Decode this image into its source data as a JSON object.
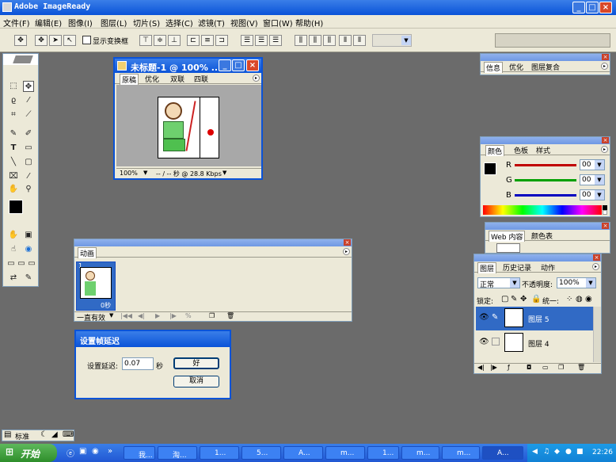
{
  "app": {
    "title": "Adobe ImageReady"
  },
  "window_buttons": {
    "minimize": "_",
    "maximize": "□",
    "close": "×"
  },
  "menu": {
    "items": [
      "文件(F)",
      "编辑(E)",
      "图像(I)",
      "图层(L)",
      "切片(S)",
      "选择(C)",
      "滤镜(T)",
      "视图(V)",
      "窗口(W)",
      "帮助(H)"
    ]
  },
  "options_bar": {
    "show_transform_label": "显示变换框"
  },
  "document": {
    "title": "未标题-1 @ 100% ...",
    "tabs": [
      "原稿",
      "优化",
      "双联",
      "四联"
    ],
    "zoom": "100%",
    "status": "-- / -- 秒 @ 28.8 Kbps"
  },
  "info_panel": {
    "tabs": [
      "信息",
      "优化",
      "图层复合"
    ]
  },
  "color_panel": {
    "tabs": [
      "颜色",
      "色板",
      "样式"
    ],
    "channels": [
      {
        "label": "R",
        "value": "00",
        "color": "#c00000"
      },
      {
        "label": "G",
        "value": "00",
        "color": "#00a000"
      },
      {
        "label": "B",
        "value": "00",
        "color": "#0000c0"
      }
    ]
  },
  "web_panel": {
    "tabs": [
      "Web 内容",
      "颜色表"
    ]
  },
  "layers_panel": {
    "tabs": [
      "图层",
      "历史记录",
      "动作"
    ],
    "blend_mode": "正常",
    "opacity_label": "不透明度:",
    "opacity": "100%",
    "lock_label": "锁定:",
    "unify_label": "统一:",
    "layers": [
      "图层 5",
      "图层 4"
    ]
  },
  "animation_panel": {
    "tab": "动画",
    "frame_number": "1",
    "frame_delay": "0秒",
    "loop": "一直有效"
  },
  "delay_dialog": {
    "title": "设置帧延迟",
    "label": "设置延迟:",
    "value": "0.07",
    "unit": "秒",
    "ok": "好",
    "cancel": "取消"
  },
  "toolbox_bottom": {
    "label": "标准"
  },
  "taskbar": {
    "start": "开始",
    "tasks": [
      "我...",
      "淘...",
      "1...",
      "5...",
      "A...",
      "m...",
      "1...",
      "m...",
      "m...",
      "A..."
    ],
    "clock": "22:26"
  },
  "colors": {
    "titlebar": "#0a53d8",
    "workspace": "#6b6b6b",
    "panel_bg": "#ece9d8",
    "taskbar": "#2157d3",
    "start": "#2e8e2b",
    "selected_layer": "#316ac5"
  }
}
